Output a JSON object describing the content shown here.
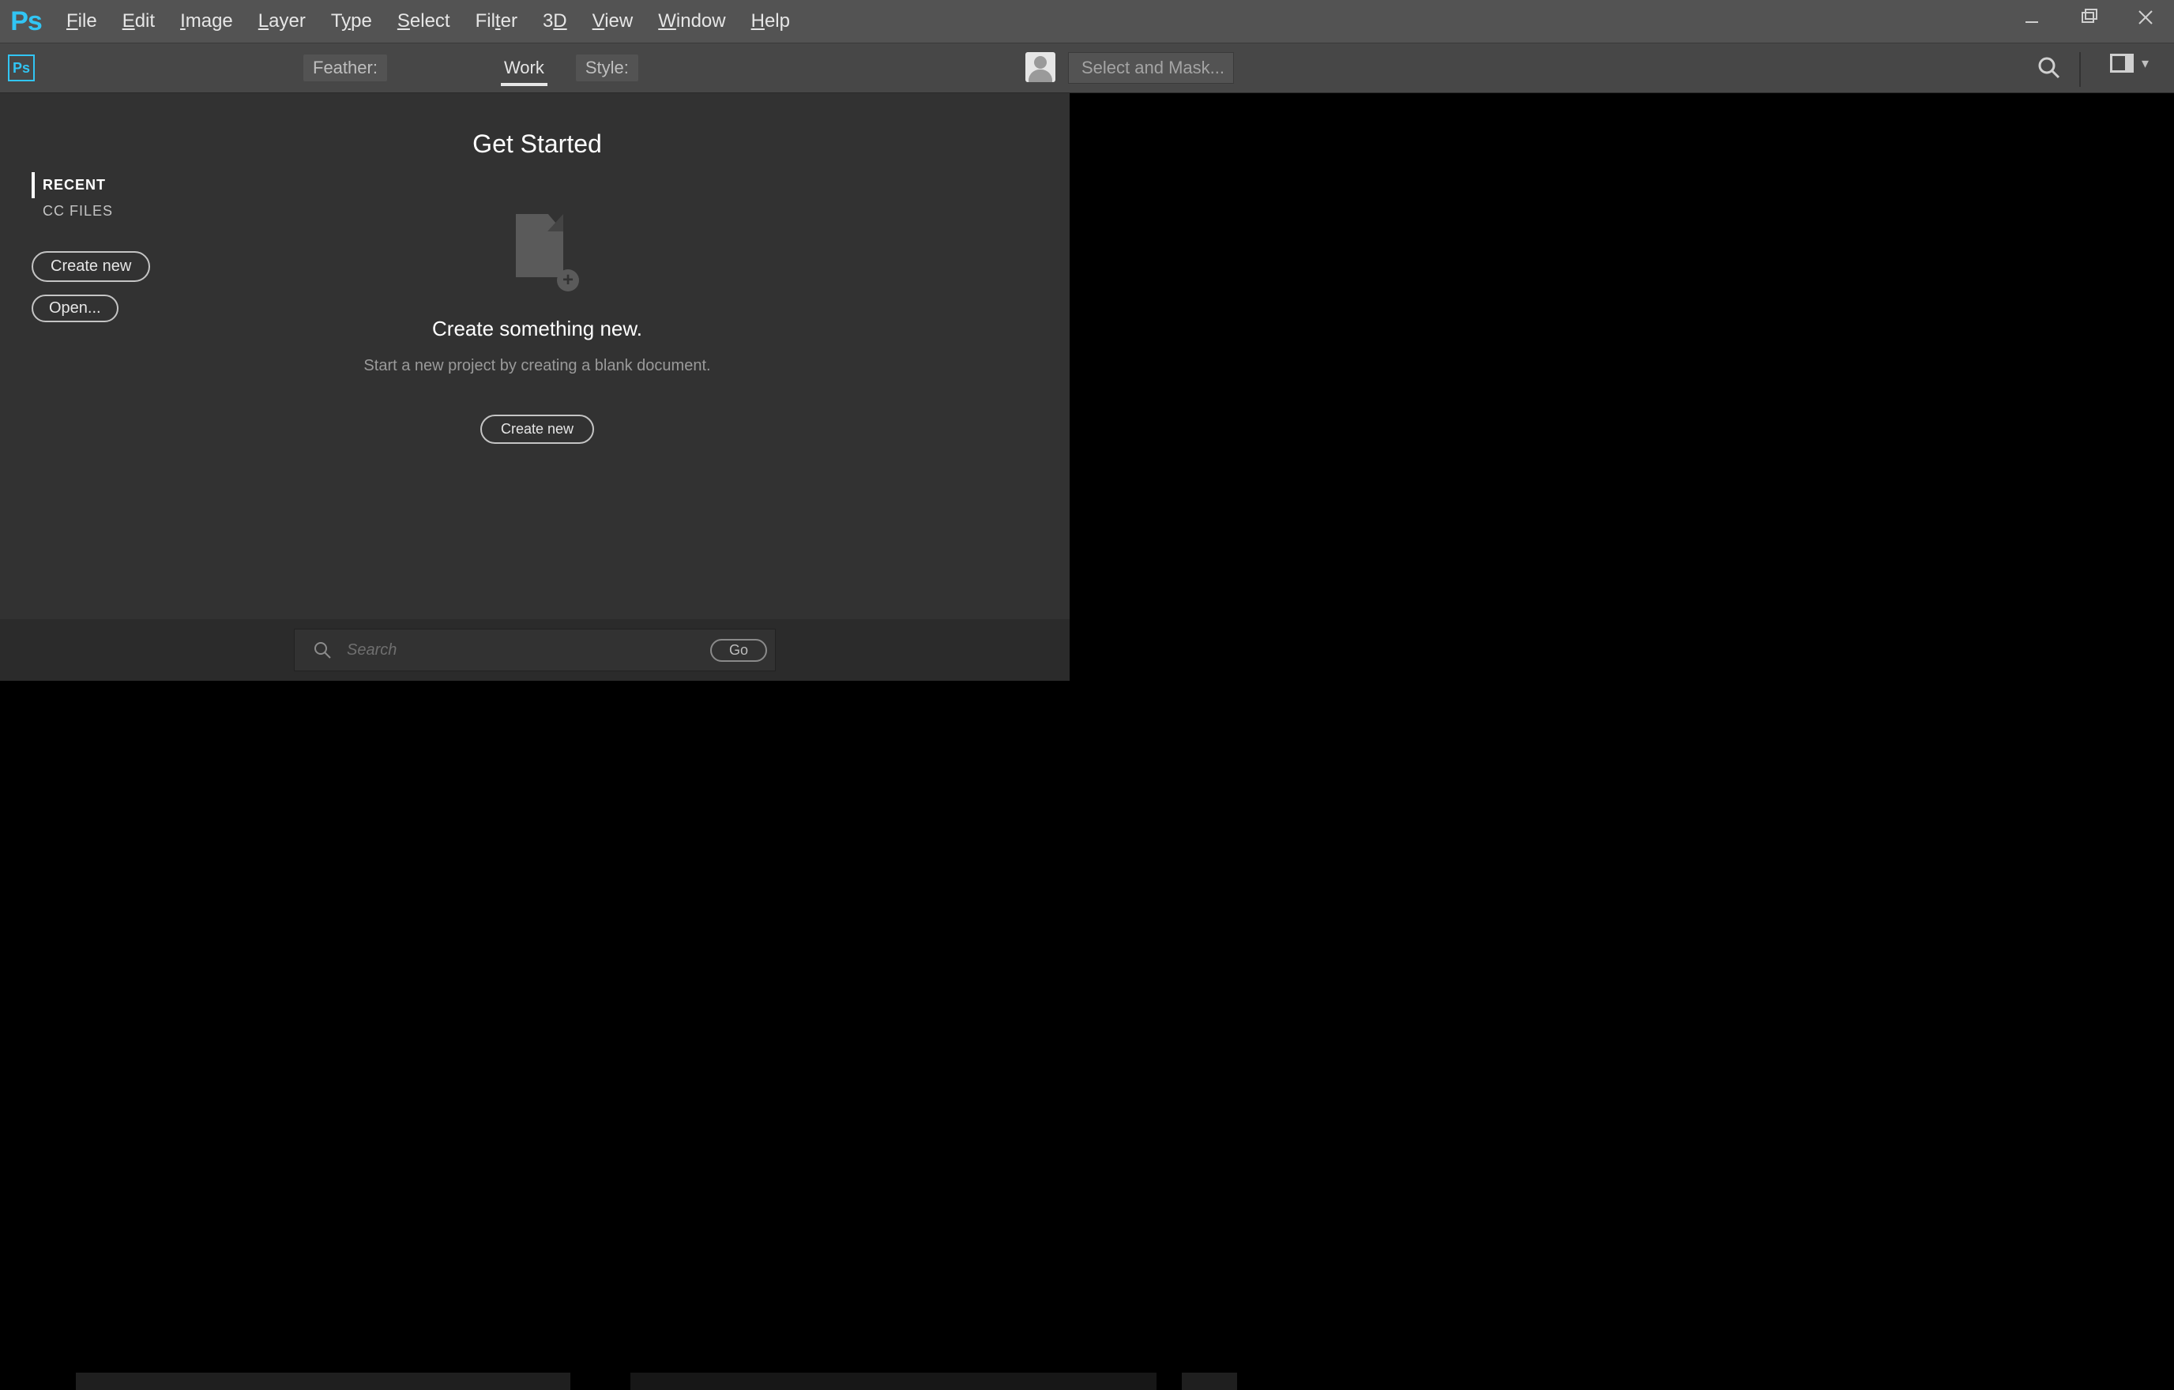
{
  "app": {
    "logo_text": "Ps"
  },
  "menu": {
    "file": "File",
    "edit": "Edit",
    "image": "Image",
    "layer": "Layer",
    "type": "Type",
    "select": "Select",
    "filter": "Filter",
    "threeD": "3D",
    "view": "View",
    "window": "Window",
    "help": "Help"
  },
  "options": {
    "ps_icon": "Ps",
    "feather_label": "Feather:",
    "work_tab": "Work",
    "style_label": "Style:",
    "select_mask": "Select and Mask..."
  },
  "start": {
    "side_tabs": {
      "recent": "RECENT",
      "cc_files": "CC FILES"
    },
    "buttons": {
      "create_new": "Create new",
      "open": "Open..."
    },
    "heading": "Get Started",
    "create_title": "Create something new.",
    "create_sub": "Start a new project by creating a blank document.",
    "center_button": "Create new",
    "search_placeholder": "Search",
    "go": "Go"
  },
  "taskbar": {
    "clock": ""
  }
}
